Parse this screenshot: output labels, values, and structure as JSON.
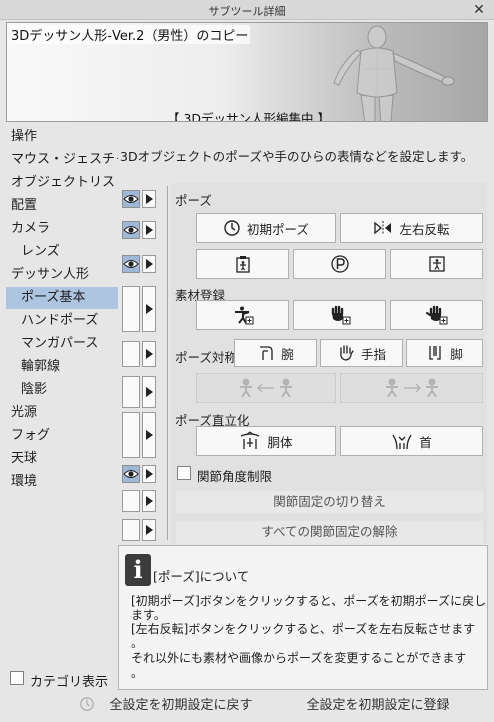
{
  "window": {
    "title": "サブツール詳細",
    "close_label": "✕"
  },
  "preview": {
    "model_name": "3Dデッサン人形-Ver.2（男性）のコピー",
    "status": "【 3Dデッサン人形編集中 】"
  },
  "categories": [
    {
      "label": "操作",
      "sub": false,
      "selected": false
    },
    {
      "label": "マウス・ジェスチャー",
      "sub": false,
      "selected": false
    },
    {
      "label": "オブジェクトリスト",
      "sub": false,
      "selected": false
    },
    {
      "label": "配置",
      "sub": false,
      "selected": false
    },
    {
      "label": "カメラ",
      "sub": false,
      "selected": false
    },
    {
      "label": "レンズ",
      "sub": true,
      "selected": false
    },
    {
      "label": "デッサン人形",
      "sub": false,
      "selected": false
    },
    {
      "label": "ポーズ基本",
      "sub": true,
      "selected": true
    },
    {
      "label": "ハンドポーズ",
      "sub": true,
      "selected": false
    },
    {
      "label": "マンガパース",
      "sub": true,
      "selected": false
    },
    {
      "label": "輪郭線",
      "sub": true,
      "selected": false
    },
    {
      "label": "陰影",
      "sub": true,
      "selected": false
    },
    {
      "label": "光源",
      "sub": false,
      "selected": false
    },
    {
      "label": "フォグ",
      "sub": false,
      "selected": false
    },
    {
      "label": "天球",
      "sub": false,
      "selected": false
    },
    {
      "label": "環境",
      "sub": false,
      "selected": false
    }
  ],
  "description": "3Dオブジェクトのポーズや手のひらの表情などを設定します。",
  "pose": {
    "section_label": "ポーズ",
    "initial_pose_label": "初期ポーズ",
    "flip_label": "左右反転"
  },
  "material": {
    "section_label": "素材登録"
  },
  "symmetry": {
    "section_label": "ポーズ対称化",
    "arm_label": "腕",
    "finger_label": "手指",
    "leg_label": "脚"
  },
  "upright": {
    "section_label": "ポーズ直立化",
    "torso_label": "胴体",
    "neck_label": "首"
  },
  "joint_limit": {
    "label": "関節角度制限",
    "checked": false
  },
  "joint_fix_toggle_label": "関節固定の切り替え",
  "release_all_label": "すべての関節固定の解除",
  "info": {
    "icon_glyph": "i",
    "title": "[ポーズ]について",
    "lines": [
      "[初期ポーズ]ボタンをクリックすると、ポーズを初期ポーズに戻し",
      "ます。",
      "[左右反転]ボタンをクリックすると、ポーズを左右反転させます",
      "。",
      "それ以外にも素材や画像からポーズを変更することができます",
      "。"
    ]
  },
  "category_display": {
    "label": "カテゴリ表示",
    "checked": false
  },
  "bottom": {
    "reset_label": "全設定を初期設定に戻す",
    "register_label": "全設定を初期設定に登録"
  },
  "colors": {
    "selection": "#aec5e2",
    "eye_active": "#9fb8d8",
    "panel": "#e1e1e1"
  }
}
